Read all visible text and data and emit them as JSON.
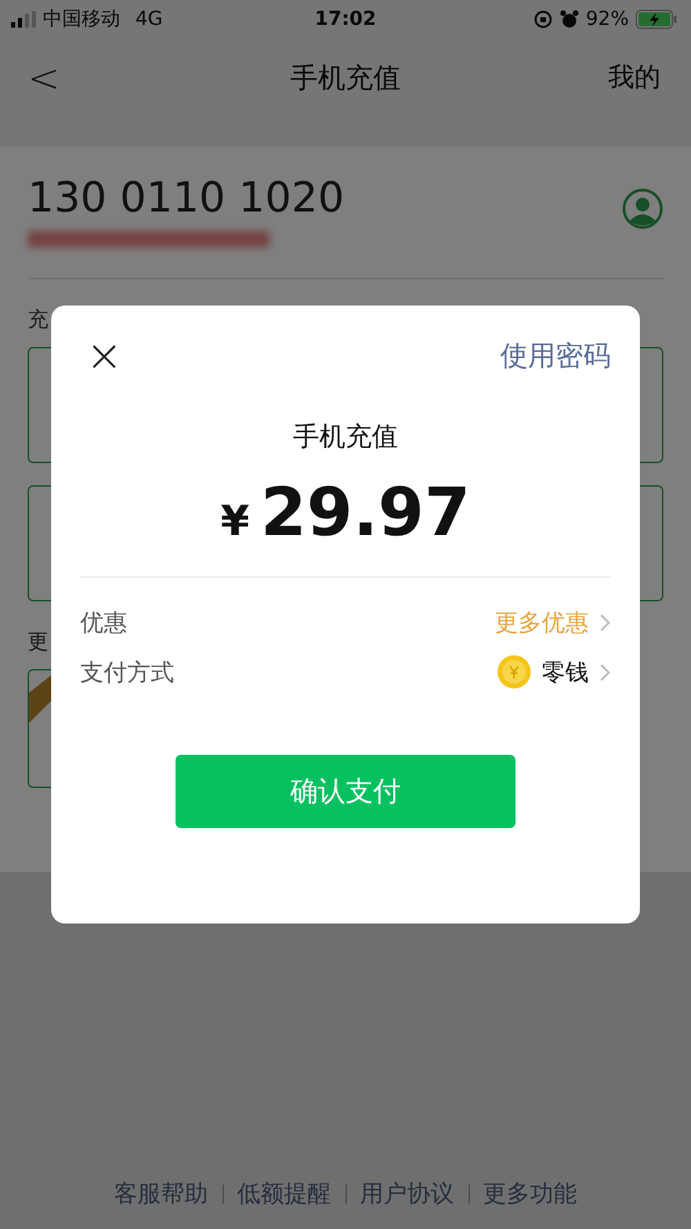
{
  "status_bar": {
    "carrier": "中国移动",
    "network": "4G",
    "time": "17:02",
    "battery": "92%",
    "charging": true
  },
  "nav": {
    "back": "<",
    "title": "手机充值",
    "action": "我的"
  },
  "account": {
    "phone": "130 0110 1020"
  },
  "sections": [
    {
      "label": "充"
    },
    {
      "label": "更"
    }
  ],
  "footer_links": [
    "客服帮助",
    "低额提醒",
    "用户协议",
    "更多功能"
  ],
  "dialog": {
    "close": "×",
    "password_link": "使用密码",
    "title": "手机充值",
    "currency": "¥",
    "amount": "29.97",
    "rows": [
      {
        "kind": "link",
        "label": "优惠",
        "value": "更多优惠"
      },
      {
        "kind": "method",
        "label": "支付方式",
        "value": "零钱"
      }
    ],
    "confirm": "确认支付"
  }
}
